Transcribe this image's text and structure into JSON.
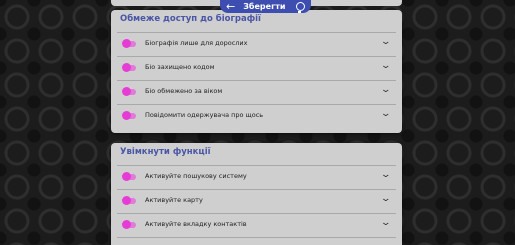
{
  "header": {
    "save_label": "Зберегти",
    "back_icon": "←",
    "hint_icon": "lightbulb"
  },
  "sections": [
    {
      "title": "Обмеже доступ до біографії",
      "items": [
        {
          "label": "Біографія лише для дорослих",
          "toggle": "off"
        },
        {
          "label": "Біо захищено кодом",
          "toggle": "off"
        },
        {
          "label": "Біо обмежено за віком",
          "toggle": "off"
        },
        {
          "label": "Повідомити одержувача про щось",
          "toggle": "off"
        }
      ]
    },
    {
      "title": "Увімкнути функції",
      "items": [
        {
          "label": "Активуйте пошукову систему",
          "toggle": "off"
        },
        {
          "label": "Активуйте карту",
          "toggle": "off"
        },
        {
          "label": "Активуйте вкладку контактів",
          "toggle": "off"
        }
      ]
    }
  ],
  "chevron_glyph": "⌄",
  "colors": {
    "accent": "#3d4db0",
    "section_title": "#4a56a6",
    "toggle": "#e63cd6",
    "card": "#cfcfcf",
    "background": "#1c1c1c"
  }
}
